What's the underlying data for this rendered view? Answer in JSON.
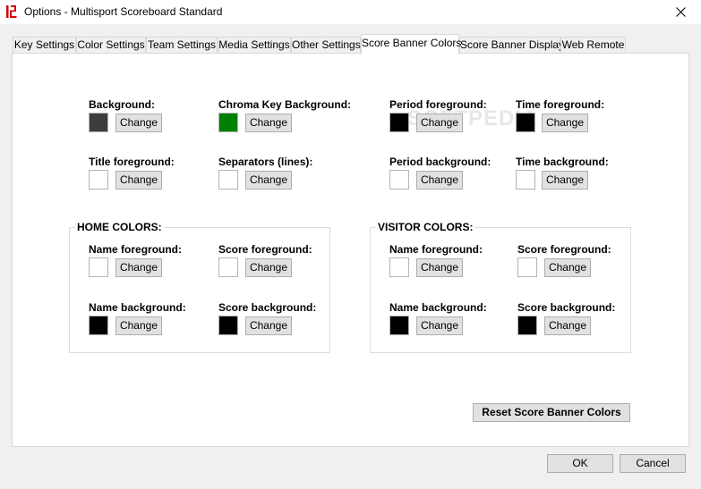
{
  "window": {
    "title": "Options - Multisport Scoreboard Standard",
    "icon": "app-logo-icon",
    "close_icon": "close-icon"
  },
  "tabs": [
    {
      "label": "Key Settings",
      "active": false
    },
    {
      "label": "Color Settings",
      "active": false
    },
    {
      "label": "Team Settings",
      "active": false
    },
    {
      "label": "Media Settings",
      "active": false
    },
    {
      "label": "Other Settings",
      "active": false
    },
    {
      "label": "Score Banner Colors",
      "active": true
    },
    {
      "label": "Score Banner Display",
      "active": false
    },
    {
      "label": "Web Remote",
      "active": false
    }
  ],
  "general": {
    "background": {
      "label": "Background:",
      "color": "#3c3c3c",
      "button": "Change"
    },
    "chroma_key": {
      "label": "Chroma Key Background:",
      "color": "#008000",
      "button": "Change"
    },
    "period_fg": {
      "label": "Period foreground:",
      "color": "#000000",
      "button": "Change"
    },
    "time_fg": {
      "label": "Time foreground:",
      "color": "#000000",
      "button": "Change"
    },
    "title_fg": {
      "label": "Title foreground:",
      "color": "#ffffff",
      "button": "Change"
    },
    "separators": {
      "label": "Separators (lines):",
      "color": "#ffffff",
      "button": "Change"
    },
    "period_bg": {
      "label": "Period background:",
      "color": "#ffffff",
      "button": "Change"
    },
    "time_bg": {
      "label": "Time background:",
      "color": "#ffffff",
      "button": "Change"
    }
  },
  "home": {
    "title": "HOME COLORS:",
    "name_fg": {
      "label": "Name foreground:",
      "color": "#ffffff",
      "button": "Change"
    },
    "score_fg": {
      "label": "Score foreground:",
      "color": "#ffffff",
      "button": "Change"
    },
    "name_bg": {
      "label": "Name background:",
      "color": "#000000",
      "button": "Change"
    },
    "score_bg": {
      "label": "Score background:",
      "color": "#000000",
      "button": "Change"
    }
  },
  "visitor": {
    "title": "VISITOR COLORS:",
    "name_fg": {
      "label": "Name foreground:",
      "color": "#ffffff",
      "button": "Change"
    },
    "score_fg": {
      "label": "Score foreground:",
      "color": "#ffffff",
      "button": "Change"
    },
    "name_bg": {
      "label": "Name background:",
      "color": "#000000",
      "button": "Change"
    },
    "score_bg": {
      "label": "Score background:",
      "color": "#000000",
      "button": "Change"
    }
  },
  "reset_button": "Reset Score Banner Colors",
  "ok_button": "OK",
  "cancel_button": "Cancel",
  "watermark": "SOFTPEDIA"
}
